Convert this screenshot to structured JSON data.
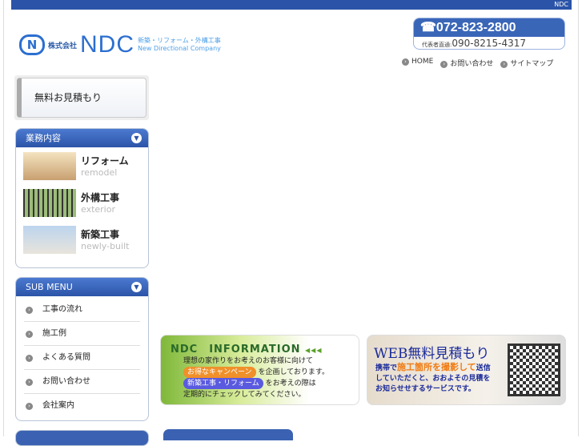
{
  "topbar": {
    "text": "NDC"
  },
  "logo": {
    "mark": "N",
    "kabushiki": "株式会社",
    "name": "NDC",
    "tagline_jp": "新築・リフォーム・外構工事",
    "tagline_en": "New Directional Company"
  },
  "phone": {
    "main": "☎072-823-2800",
    "direct_label": "代表者直通:",
    "direct": "090-8215-4317"
  },
  "topnav": [
    {
      "label": "HOME"
    },
    {
      "label": "お問い合わせ"
    },
    {
      "label": "サイトマップ"
    }
  ],
  "estimate_button": "無料お見積もり",
  "services": {
    "title": "業務内容",
    "items": [
      {
        "jp": "リフォーム",
        "en": "remodel"
      },
      {
        "jp": "外構工事",
        "en": "exterior"
      },
      {
        "jp": "新築工事",
        "en": "newly-built"
      }
    ]
  },
  "submenu": {
    "title": "SUB MENU",
    "items": [
      {
        "label": "工事の流れ"
      },
      {
        "label": "施工例"
      },
      {
        "label": "よくある質問"
      },
      {
        "label": "お問い合わせ"
      },
      {
        "label": "会社案内"
      }
    ]
  },
  "info_banner": {
    "title": "NDC　INFORMATION",
    "arrows": "◀◀◀",
    "line1": "理想の家作りをお考えのお客様に向けて",
    "pill1": "お得なキャンペーン",
    "line2": "を企画しております。",
    "pill2": "新築工事・リフォーム",
    "line3": "をお考えの際は",
    "line4": "定期的にチェックしてみてください。"
  },
  "web_banner": {
    "title": "WEB無料見積もり",
    "l1a": "携帯で",
    "l1b": "施工箇所を撮影して",
    "l1c": "送信",
    "line2": "していただくと、おおよその見積を",
    "line3": "お知らせせするサービスです。"
  },
  "colors": {
    "brand": "#2b54a8",
    "orange": "#f0902a",
    "purple": "#5a5ae0"
  }
}
